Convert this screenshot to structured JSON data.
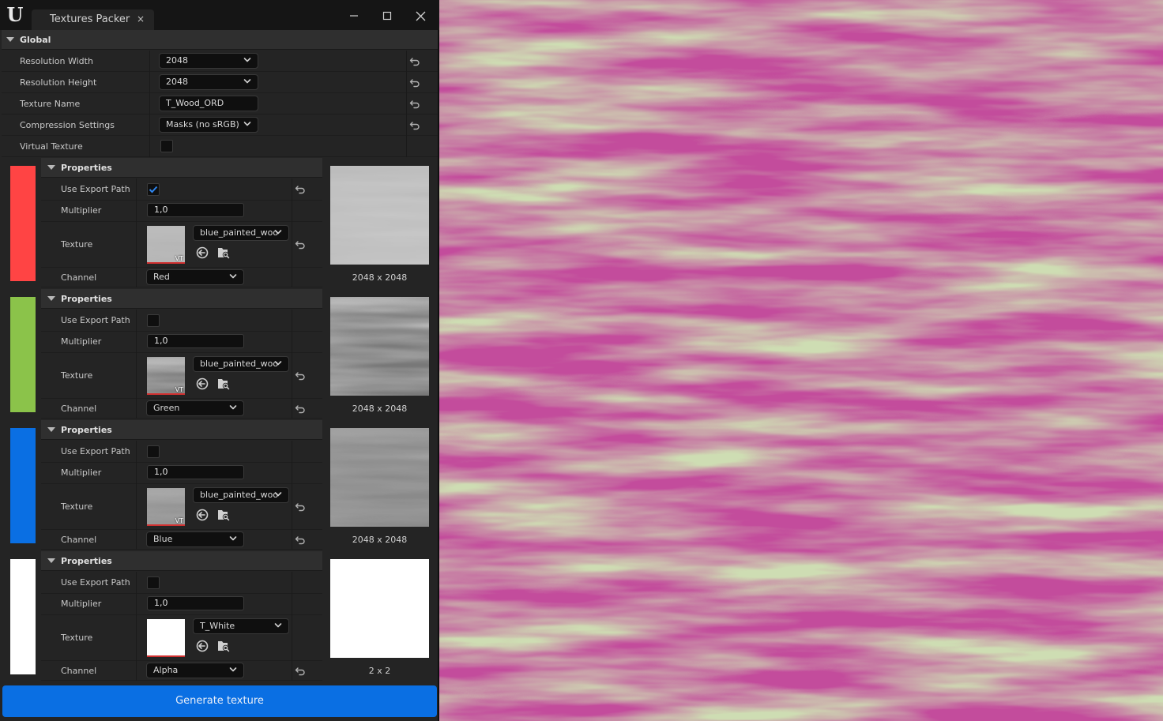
{
  "window": {
    "tab_title": "Textures Packer",
    "tab_close": "×"
  },
  "global": {
    "header": "Global",
    "resolution_width": {
      "label": "Resolution Width",
      "value": "2048"
    },
    "resolution_height": {
      "label": "Resolution Height",
      "value": "2048"
    },
    "texture_name": {
      "label": "Texture Name",
      "value": "T_Wood_ORD"
    },
    "compression": {
      "label": "Compression Settings",
      "value": "Masks (no sRGB)"
    },
    "virtual_texture": {
      "label": "Virtual Texture",
      "checked": false
    }
  },
  "channels": [
    {
      "header": "Properties",
      "swatch_color": "#ff4444",
      "use_export_path": {
        "label": "Use Export Path",
        "checked": true
      },
      "multiplier": {
        "label": "Multiplier",
        "value": "1,0"
      },
      "texture": {
        "label": "Texture",
        "asset": "blue_painted_woo",
        "vt_badge": "VT"
      },
      "channel": {
        "label": "Channel",
        "value": "Red"
      },
      "preview_size": "2048 x 2048"
    },
    {
      "header": "Properties",
      "swatch_color": "#8bc34a",
      "use_export_path": {
        "label": "Use Export Path",
        "checked": false
      },
      "multiplier": {
        "label": "Multiplier",
        "value": "1,0"
      },
      "texture": {
        "label": "Texture",
        "asset": "blue_painted_woo",
        "vt_badge": "VT"
      },
      "channel": {
        "label": "Channel",
        "value": "Green"
      },
      "preview_size": "2048 x 2048"
    },
    {
      "header": "Properties",
      "swatch_color": "#0a6fe3",
      "use_export_path": {
        "label": "Use Export Path",
        "checked": false
      },
      "multiplier": {
        "label": "Multiplier",
        "value": "1,0"
      },
      "texture": {
        "label": "Texture",
        "asset": "blue_painted_woo",
        "vt_badge": "VT"
      },
      "channel": {
        "label": "Channel",
        "value": "Blue"
      },
      "preview_size": "2048 x 2048"
    },
    {
      "header": "Properties",
      "swatch_color": "#ffffff",
      "use_export_path": {
        "label": "Use Export Path",
        "checked": false
      },
      "multiplier": {
        "label": "Multiplier",
        "value": "1,0"
      },
      "texture": {
        "label": "Texture",
        "asset": "T_White",
        "vt_badge": ""
      },
      "channel": {
        "label": "Channel",
        "value": "Alpha"
      },
      "preview_size": "2 x 2"
    }
  ],
  "footer": {
    "generate_label": "Generate texture"
  },
  "colors": {
    "accent": "#0a6fe3",
    "panel_bg": "#242424",
    "viewport_tint": "#c34c9c"
  }
}
